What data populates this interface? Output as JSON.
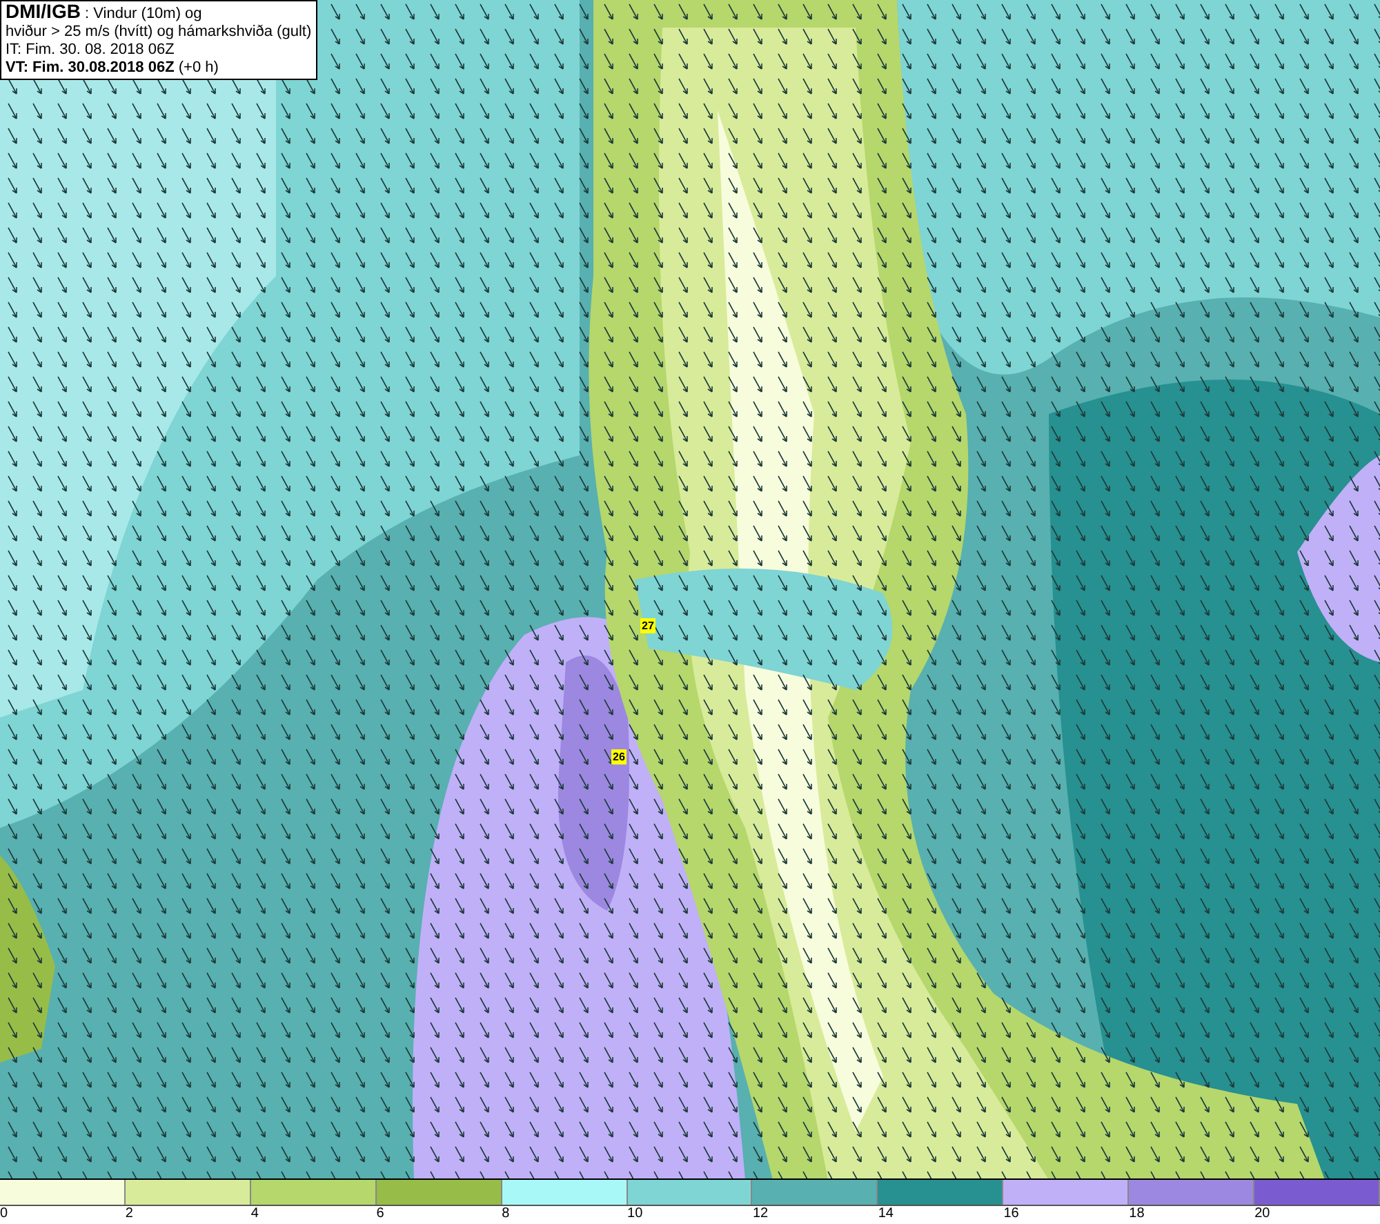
{
  "title_box": {
    "lines": [
      "**DMI/IGB** : Vindur (10m) og",
      "hviður > 25 m/s (hvítt) og hámarkshviða (gult)",
      "IT: Fim. 30. 08. 2018 06Z",
      "**VT: Fim. 30.08.2018 06Z** (+0 h)"
    ]
  },
  "map": {
    "labels": [
      {
        "text": "27"
      },
      {
        "text": "26"
      }
    ]
  },
  "legend": [
    {
      "label": "0",
      "color": "#f7fcdc"
    },
    {
      "label": "2",
      "color": "#d8eb9a"
    },
    {
      "label": "4",
      "color": "#b5d76c"
    },
    {
      "label": "6",
      "color": "#97bd48"
    },
    {
      "label": "8",
      "color": "#a8f8f8"
    },
    {
      "label": "10",
      "color": "#7fd4d4"
    },
    {
      "label": "12",
      "color": "#58b0b0"
    },
    {
      "label": "14",
      "color": "#279090"
    },
    {
      "label": "16",
      "color": "#c0b0f8"
    },
    {
      "label": "18",
      "color": "#9c88e0"
    },
    {
      "label": "20",
      "color": "#7a5cd0"
    }
  ]
}
